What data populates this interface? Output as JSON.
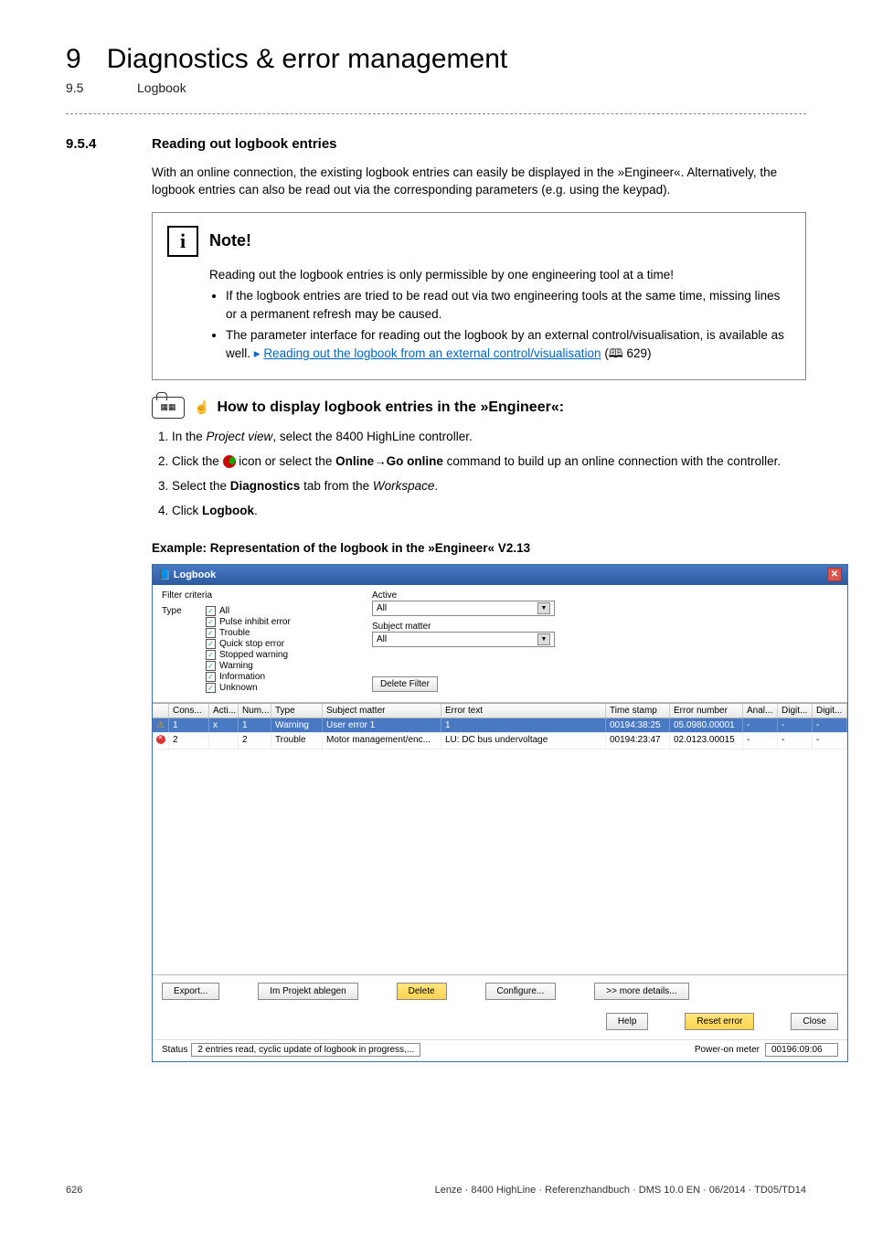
{
  "chapter": {
    "num": "9",
    "title": "Diagnostics & error management"
  },
  "sub": {
    "num": "9.5",
    "title": "Logbook"
  },
  "section": {
    "num": "9.5.4",
    "title": "Reading out logbook entries"
  },
  "para1": "With an online connection, the existing logbook entries can easily be displayed in the »Engineer«. Alternatively, the logbook entries can also be read out via the corresponding parameters (e.g. using the keypad).",
  "note": {
    "title": "Note!",
    "line1": "Reading out the logbook entries is only permissible by one engineering tool at a time!",
    "b1": "If the logbook entries are tried to be read out via two engineering tools at the same time, missing lines or a permanent refresh may be caused.",
    "b2a": "The parameter interface for reading out the logbook by an external control/visualisation, is available as well.",
    "b2_link": "Reading out the logbook from an external control/visualisation",
    "b2_pg": "629"
  },
  "howto_title": "How to display logbook entries in the »Engineer«:",
  "steps": {
    "s1a": "In the ",
    "s1b": "Project view",
    "s1c": ", select the 8400 HighLine controller.",
    "s2a": "Click the ",
    "s2b": " icon or select the ",
    "s2c": "Online",
    "s2d": "Go online",
    "s2e": " command to build up an online connection with the controller.",
    "s3a": "Select the ",
    "s3b": "Diagnostics",
    "s3c": " tab from the ",
    "s3d": "Workspace",
    "s3e": ".",
    "s4a": "Click ",
    "s4b": "Logbook",
    "s4c": "."
  },
  "example_title": "Example: Representation of the logbook in the »Engineer« V2.13",
  "dlg": {
    "title": "Logbook",
    "filter_criteria": "Filter criteria",
    "type_lbl": "Type",
    "cb": [
      "All",
      "Pulse inhibit error",
      "Trouble",
      "Quick stop error",
      "Stopped warning",
      "Warning",
      "Information",
      "Unknown"
    ],
    "active_lbl": "Active",
    "active_val": "All",
    "subject_lbl": "Subject matter",
    "subject_val": "All",
    "delete_filter": "Delete Filter",
    "cols": [
      "Cons...",
      "Acti...",
      "Num...",
      "Type",
      "Subject matter",
      "Error text",
      "Time stamp",
      "Error number",
      "Anal...",
      "Digit...",
      "Digit..."
    ],
    "rows": [
      {
        "icon": "warn",
        "cons": "1",
        "acti": "x",
        "num": "1",
        "type": "Warning",
        "subj": "User error 1",
        "err": "1",
        "ts": "00194:38:25",
        "en": "05.0980.00001",
        "anal": "-",
        "d1": "-",
        "d2": "-"
      },
      {
        "icon": "err",
        "cons": "2",
        "acti": "",
        "num": "2",
        "type": "Trouble",
        "subj": "Motor management/enc...",
        "err": "LU: DC bus undervoltage",
        "ts": "00194:23:47",
        "en": "02.0123.00015",
        "anal": "-",
        "d1": "-",
        "d2": "-"
      }
    ],
    "btns": {
      "export": "Export...",
      "save": "Im Projekt ablegen",
      "delete": "Delete",
      "configure": "Configure...",
      "more": ">> more details...",
      "help": "Help",
      "reset": "Reset error",
      "close": "Close"
    },
    "status_label": "Status",
    "status": "2 entries read, cyclic update of logbook in progress,...",
    "pom_lbl": "Power-on meter",
    "pom_val": "00196:09:06"
  },
  "footer": {
    "page": "626",
    "imprint": "Lenze · 8400 HighLine · Referenzhandbuch · DMS 10.0 EN · 06/2014 · TD05/TD14"
  }
}
